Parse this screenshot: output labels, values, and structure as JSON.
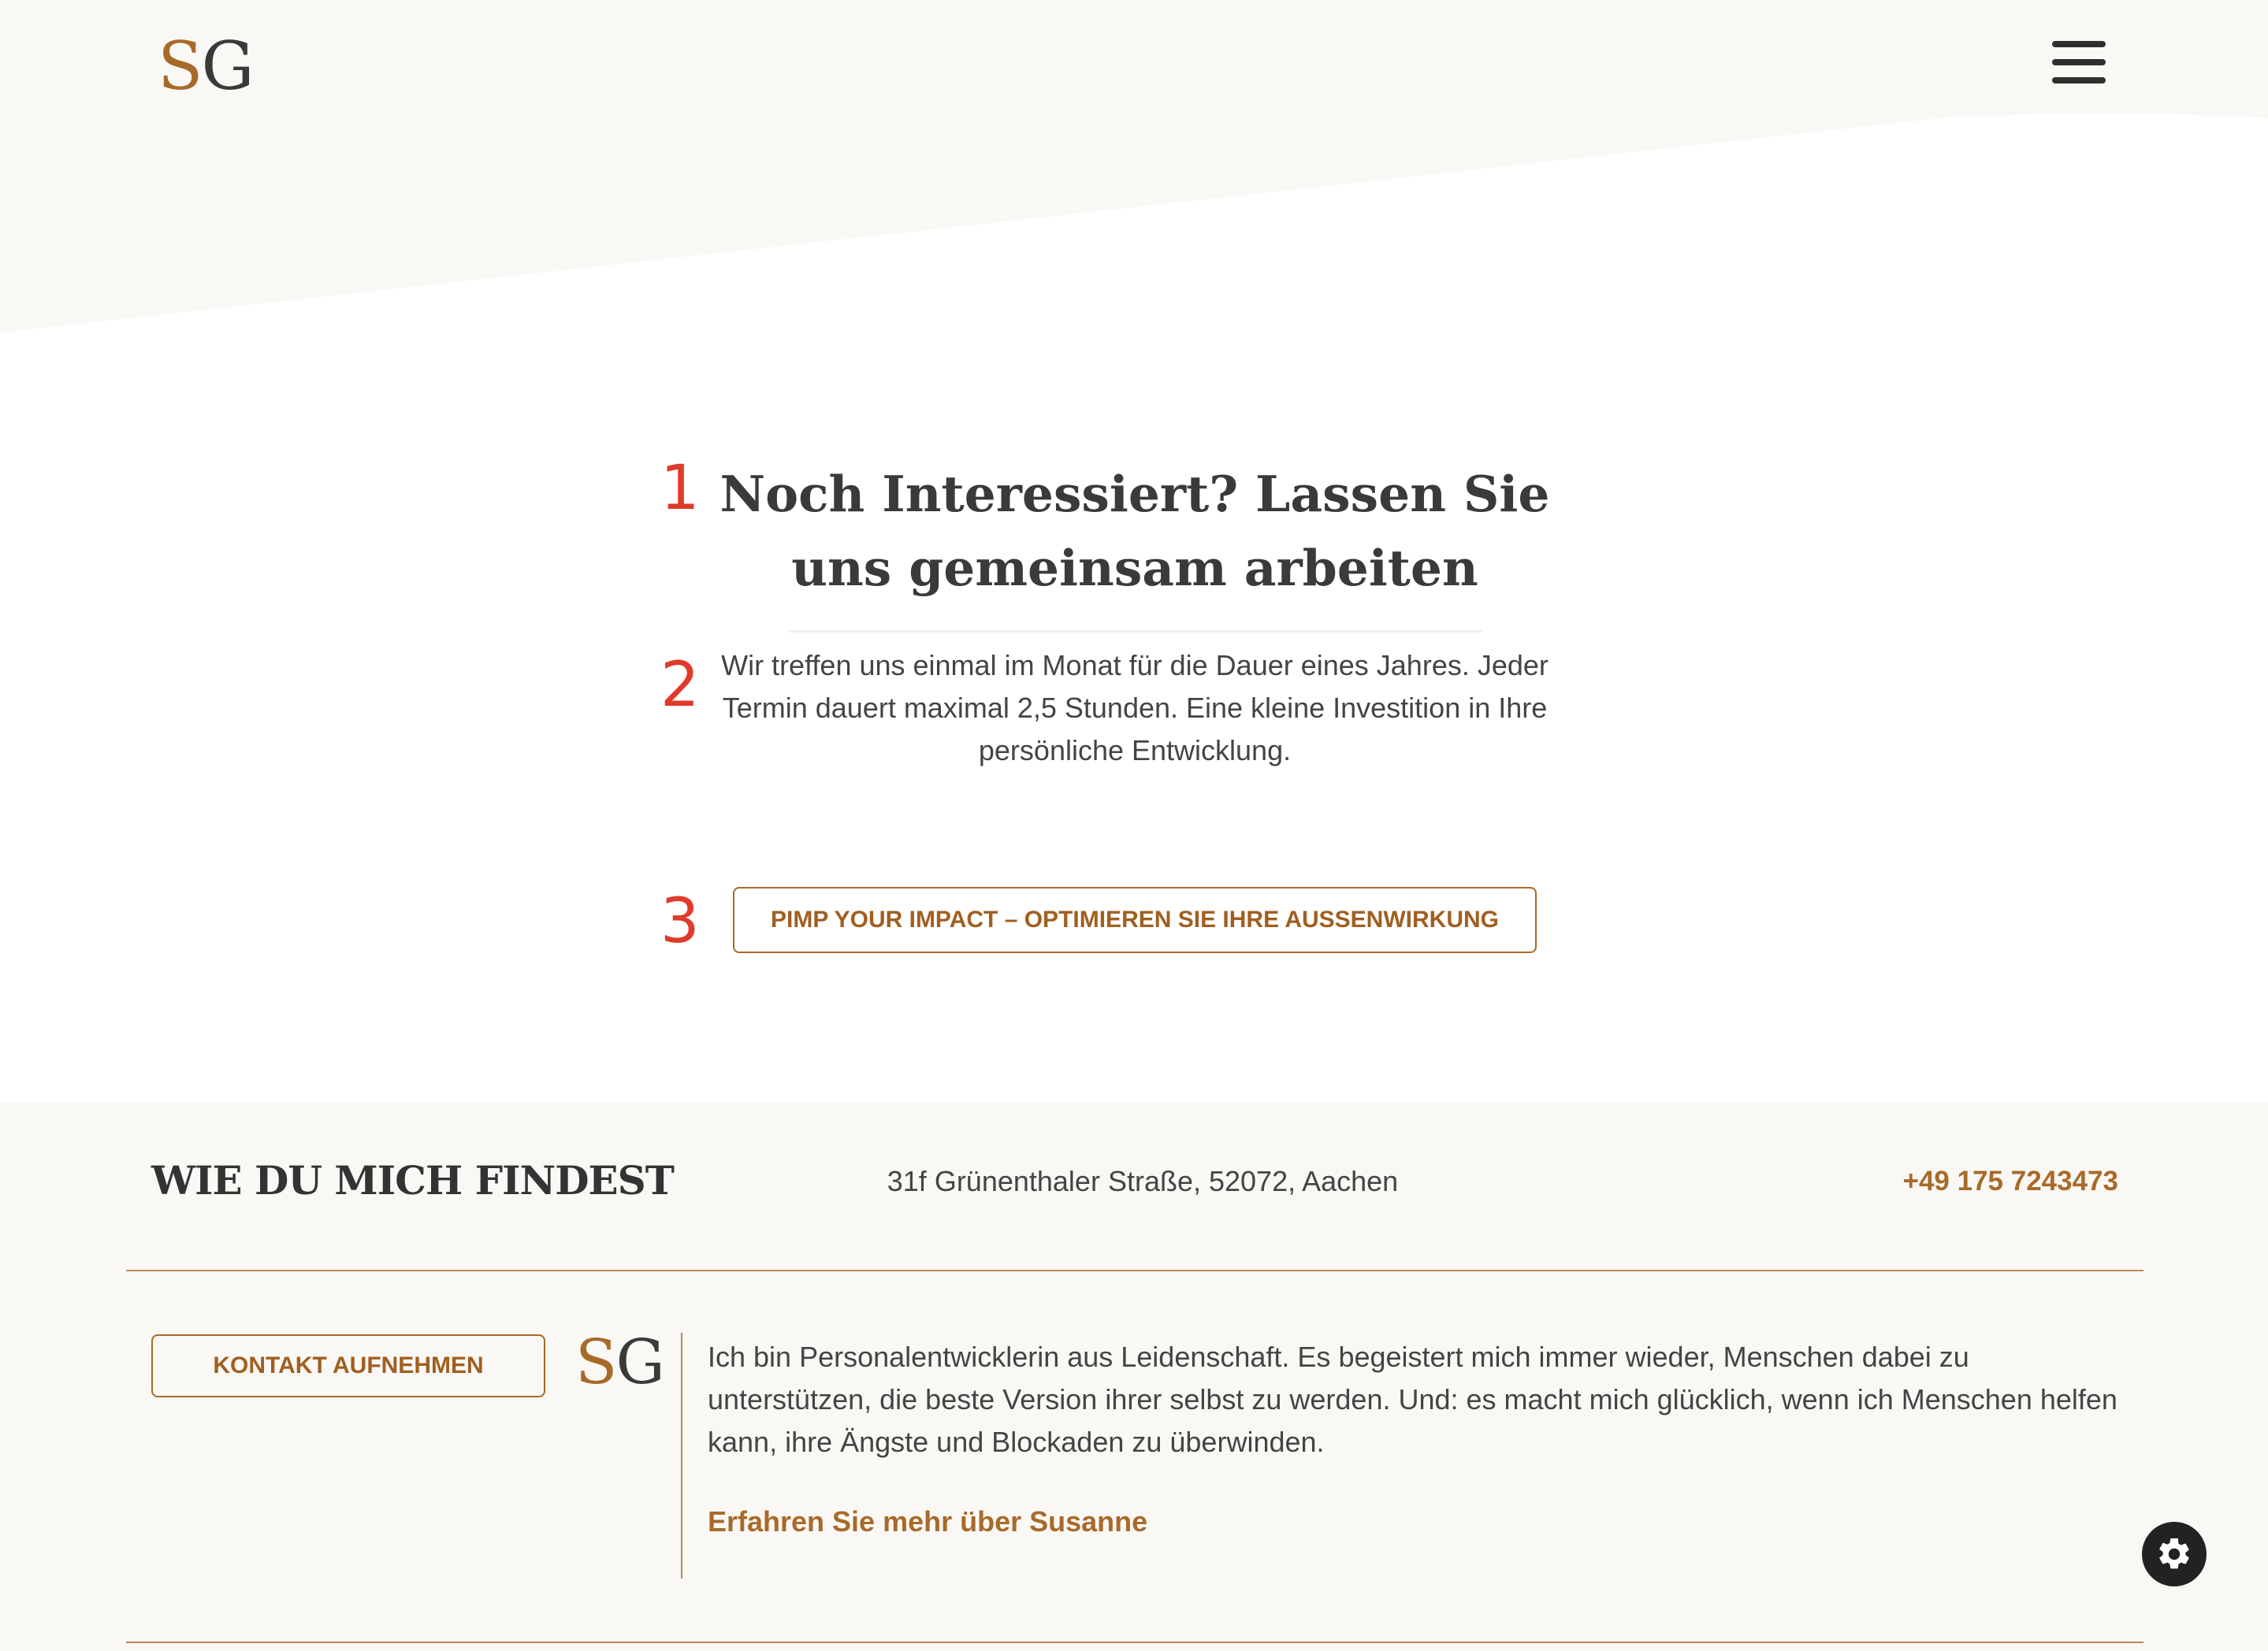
{
  "header": {
    "logo_s": "S",
    "logo_g": "G",
    "menu_icon": "hamburger-icon"
  },
  "cta": {
    "markers": [
      "1",
      "2",
      "3"
    ],
    "title": "Noch Interessiert? Lassen Sie uns gemeinsam arbeiten",
    "text": "Wir treffen uns einmal im Monat für die Dauer eines Jahres. Jeder Termin dauert maximal 2,5 Stunden. Eine kleine Investition in Ihre persönliche Entwicklung.",
    "button_label": "PIMP YOUR IMPACT – OPTIMIEREN SIE IHRE AUSSENWIRKUNG"
  },
  "footer": {
    "heading": "WIE DU MICH FINDEST",
    "address": "31f Grünenthaler Straße, 52072, Aachen",
    "phone": "+49 175 7243473",
    "contact_button": "KONTAKT AUFNEHMEN",
    "logo_s": "S",
    "logo_g": "G",
    "about_text": "Ich bin Personalentwicklerin aus Leidenschaft. Es begeistert mich immer wieder, Menschen dabei zu unterstützen, die beste Version ihrer selbst zu werden. Und: es macht mich glücklich, wenn ich Menschen helfen kann, ihre Ängste und Blockaden zu überwinden.",
    "about_link": "Erfahren Sie mehr über Susanne"
  },
  "settings_icon": "gear-icon",
  "colors": {
    "accent": "#a86a2a",
    "marker": "#e03a2a",
    "footer_bg": "#faf8f5",
    "header_bg": "#faf8f5",
    "text": "#333333"
  }
}
